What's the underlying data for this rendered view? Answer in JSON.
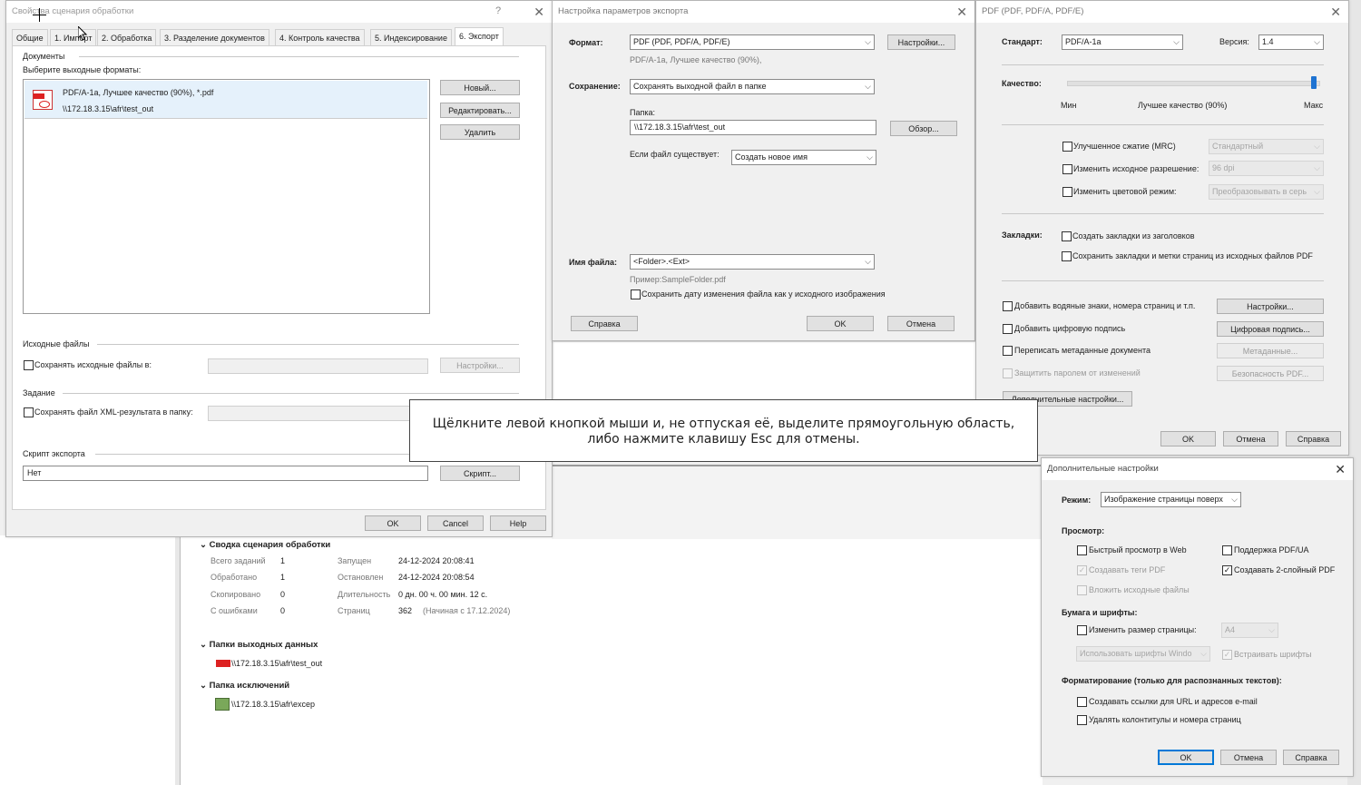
{
  "dlg1": {
    "title": "Свойства сценария обработки",
    "help_q": "?",
    "close": "✕",
    "tabs": [
      "Общие",
      "1. Импорт",
      "2. Обработка",
      "3. Разделение документов",
      "4. Контроль качества",
      "5. Индексирование",
      "6. Экспорт"
    ],
    "documents_group": "Документы",
    "select_formats": "Выберите выходные форматы:",
    "format_item_line1": "PDF/A-1a, Лучшее качество (90%), *.pdf",
    "format_item_line2": "\\\\172.18.3.15\\afr\\test_out",
    "new_btn": "Новый...",
    "edit_btn": "Редактировать...",
    "delete_btn": "Удалить",
    "source_group": "Исходные файлы",
    "save_source": "Сохранять исходные файлы в:",
    "settings_btn": "Настройки...",
    "task_group": "Задание",
    "save_xml": "Сохранять файл XML-результата в папку:",
    "script_group": "Скрипт экспорта",
    "script_value": "Нет",
    "script_btn": "Скрипт...",
    "ok": "OK",
    "cancel": "Cancel",
    "help": "Help"
  },
  "dlg2": {
    "title": "Настройка параметров экспорта",
    "close": "✕",
    "format_label": "Формат:",
    "format_value": "PDF (PDF, PDF/A, PDF/E)",
    "format_settings": "Настройки...",
    "format_hint": "PDF/A-1a, Лучшее качество (90%),",
    "save_label": "Сохранение:",
    "save_value": "Сохранять выходной файл в папке",
    "folder_label": "Папка:",
    "folder_value": "\\\\172.18.3.15\\afr\\test_out",
    "browse": "Обзор...",
    "exists_label": "Если файл существует:",
    "exists_value": "Создать новое имя",
    "filename_label": "Имя файла:",
    "filename_value": "<Folder>.<Ext>",
    "example": "Пример:SampleFolder.pdf",
    "keep_date": "Сохранить дату изменения файла как у исходного изображения",
    "help": "Справка",
    "ok": "OK",
    "cancel": "Отмена"
  },
  "dlg3": {
    "title": "PDF (PDF, PDF/A, PDF/E)",
    "close": "✕",
    "standard_label": "Стандарт:",
    "standard_value": "PDF/A-1a",
    "version_label": "Версия:",
    "version_value": "1.4",
    "quality_label": "Качество:",
    "quality_level": 0.99,
    "min": "Мин",
    "best": "Лучшее качество (90%)",
    "max": "Макс",
    "mrc": "Улучшенное сжатие (MRC)",
    "mrc_value": "Стандартный",
    "resolution": "Изменить исходное разрешение:",
    "resolution_value": "96 dpi",
    "color_mode": "Изменить цветовой режим:",
    "color_value": "Преобразовывать в серь",
    "bookmarks_label": "Закладки:",
    "bm_headers": "Создать закладки из заголовков",
    "bm_keep": "Сохранить закладки и метки страниц из исходных файлов PDF",
    "watermarks": "Добавить водяные знаки, номера страниц и т.п.",
    "wm_settings": "Настройки...",
    "digital_sig": "Добавить цифровую подпись",
    "sig_btn": "Цифровая подпись...",
    "metadata": "Переписать метаданные документа",
    "meta_btn": "Метаданные...",
    "protect": "Защитить паролем от изменений",
    "security_btn": "Безопасность PDF...",
    "advanced_btn": "Дополнительные настройки...",
    "ok": "OK",
    "cancel": "Отмена",
    "help": "Справка"
  },
  "dlg4": {
    "title": "Дополнительные настройки",
    "close": "✕",
    "mode_label": "Режим:",
    "mode_value": "Изображение страницы поверх",
    "view_label": "Просмотр:",
    "fast_web": "Быстрый просмотр в Web",
    "pdfua": "Поддержка PDF/UA",
    "tags": "Создавать теги PDF",
    "two_layer": "Создавать 2-слойный PDF",
    "embed_src": "Вложить исходные файлы",
    "paper_label": "Бумага и шрифты:",
    "resize": "Изменить размер страницы:",
    "page_size": "A4",
    "fonts_value": "Использовать шрифты Windo",
    "embed_fonts": "Встраивать шрифты",
    "format_label": "Форматирование (только для распознанных текстов):",
    "links": "Создавать ссылки для URL и адресов e-mail",
    "remove_hf": "Удалять колонтитулы и номера страниц",
    "ok": "OK",
    "cancel": "Отмена",
    "help": "Справка"
  },
  "summary": {
    "title": "Сводка сценария обработки",
    "rows": [
      {
        "k": "Всего заданий",
        "v": "1",
        "k2": "Запущен",
        "v2": "24-12-2024 20:08:41"
      },
      {
        "k": "Обработано",
        "v": "1",
        "k2": "Остановлен",
        "v2": "24-12-2024 20:08:54"
      },
      {
        "k": "Скопировано",
        "v": "0",
        "k2": "Длительность",
        "v2": "0 дн. 00 ч. 00 мин. 12 с."
      },
      {
        "k": "С ошибками",
        "v": "0",
        "k2": "Страниц",
        "v2": "362"
      }
    ],
    "pages_note": "(Начиная с 17.12.2024)",
    "out_title": "Папки выходных данных",
    "out_path": "\\\\172.18.3.15\\afr\\test_out",
    "exc_title": "Папка исключений",
    "exc_path": "\\\\172.18.3.15\\afr\\excep"
  },
  "overlay": {
    "line1": "Щёлкните левой кнопкой мыши и, не отпуская её, выделите прямоугольную область,",
    "line2": "либо нажмите клавишу Esc для отмены."
  }
}
